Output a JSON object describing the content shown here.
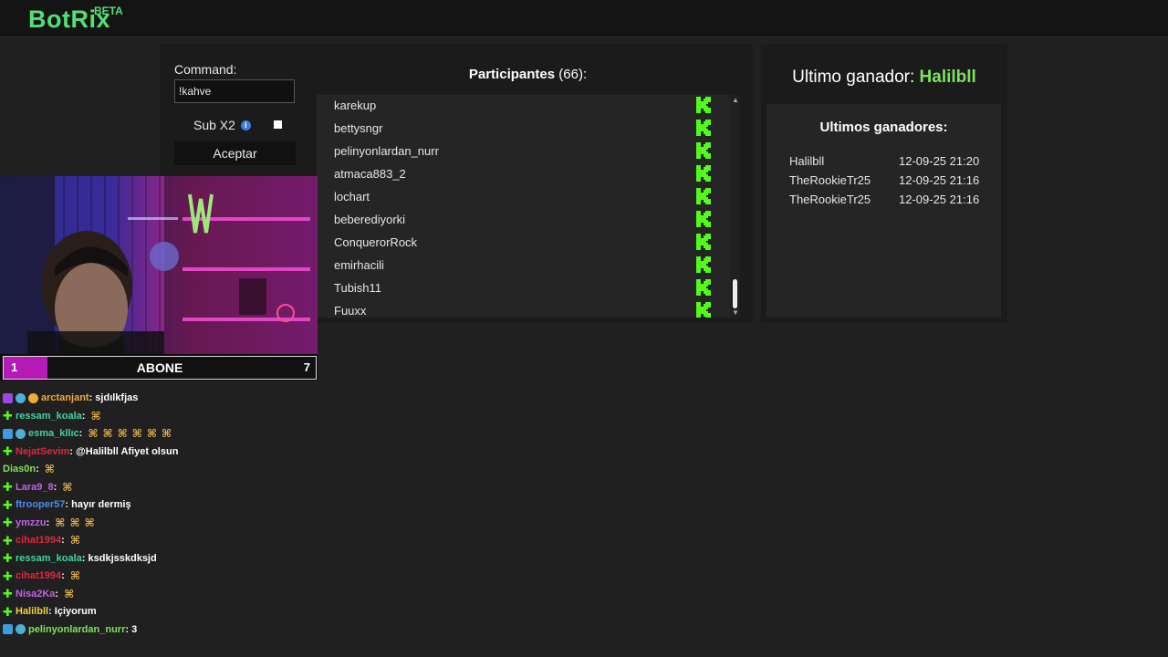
{
  "brand": {
    "name": "BotRix",
    "beta": "BETA"
  },
  "form": {
    "command_label": "Command:",
    "command_value": "!kahve",
    "sub_label": "Sub X2",
    "sub_checked": false,
    "accept_label": "Aceptar"
  },
  "participants": {
    "title": "Participantes",
    "count": "(66):",
    "items": [
      "karekup",
      "bettysngr",
      "pelinyonlardan_nurr",
      "atmaca883_2",
      "lochart",
      "beberediyorki",
      "ConquerorRock",
      "emirhacili",
      "Tubish11",
      "Fuuxx"
    ]
  },
  "winner": {
    "label": "Ultimo ganador:",
    "name": "Halilbll",
    "list_title": "Ultimos ganadores:",
    "list": [
      {
        "name": "Halilbll",
        "date": "12-09-25 21:20"
      },
      {
        "name": "TheRookieTr25",
        "date": "12-09-25 21:16"
      },
      {
        "name": "TheRookieTr25",
        "date": "12-09-25 21:16"
      }
    ]
  },
  "subgoal": {
    "start": "1",
    "label": "ABONE",
    "end": "7",
    "progress": 0.14,
    "fill_color": "#b51ab7"
  },
  "colors": {
    "accent": "#52e074",
    "winner": "#7be35a",
    "kick": "#53fc18"
  },
  "chat": [
    {
      "user": "arctanjant",
      "color": "#f0a93a",
      "text": " : sjdılkfjas",
      "badges": [
        "purple",
        "gem",
        "coin"
      ]
    },
    {
      "user": "ressam_koala",
      "color": "#41d3a0",
      "text": " :",
      "badges": [
        "plus"
      ],
      "emotes": 1
    },
    {
      "user": "esma_kllıc",
      "color": "#41d3a0",
      "text": " :",
      "badges": [
        "blue",
        "gem"
      ],
      "emotes": 6
    },
    {
      "user": "NejatSevim",
      "color": "#e0263b",
      "text": " : @Halilbll Afiyet olsun",
      "badges": [
        "plus"
      ]
    },
    {
      "user": "Dias0n",
      "color": "#7be35a",
      "text": " :",
      "badges": [],
      "emotes": 1
    },
    {
      "user": "Lara9_8",
      "color": "#c062e6",
      "text": " :",
      "badges": [
        "plus"
      ],
      "emotes": 1
    },
    {
      "user": "ftrooper57",
      "color": "#4b8cf0",
      "text": " : hayır dermiş",
      "badges": [
        "plus"
      ]
    },
    {
      "user": "ymzzu",
      "color": "#c062e6",
      "text": " :",
      "badges": [
        "plus"
      ],
      "emotes": 3
    },
    {
      "user": "cihat1994",
      "color": "#e0263b",
      "text": " :",
      "badges": [
        "plus"
      ],
      "emotes": 1
    },
    {
      "user": "ressam_koala",
      "color": "#41d3a0",
      "text": " : ksdkjsskdksjd",
      "badges": [
        "plus"
      ]
    },
    {
      "user": "cihat1994",
      "color": "#e0263b",
      "text": " :",
      "badges": [
        "plus"
      ],
      "emotes": 1
    },
    {
      "user": "Nisa2Ka",
      "color": "#c062e6",
      "text": " :",
      "badges": [
        "plus"
      ],
      "emotes": 1
    },
    {
      "user": "Halilbll",
      "color": "#f0d23a",
      "text": " : Içiyorum",
      "badges": [
        "plus"
      ]
    },
    {
      "user": "pelinyonlardan_nurr",
      "color": "#7be35a",
      "text": " : 3",
      "badges": [
        "blue",
        "gem"
      ]
    }
  ]
}
